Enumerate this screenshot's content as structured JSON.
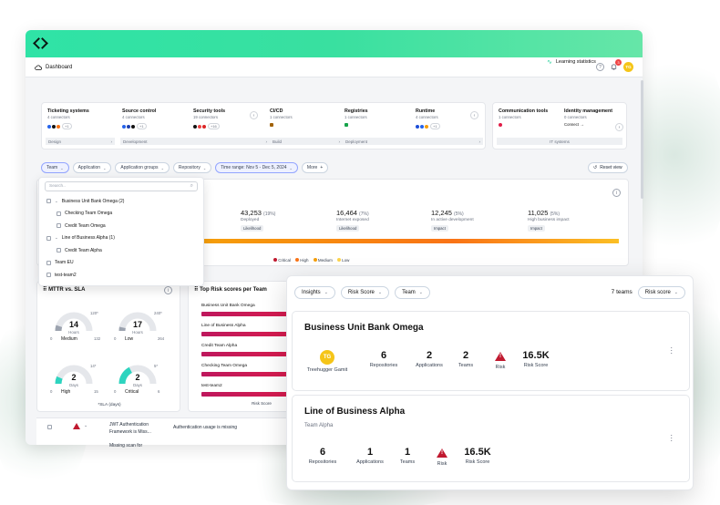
{
  "header": {
    "breadcrumb": "Dashboard",
    "notif_count": "3",
    "avatar": "TG"
  },
  "learning": "Learning statistics",
  "connectors": [
    {
      "title": "Ticketing systems",
      "sub": "4 connectors",
      "plus": "+1",
      "cat": "Design"
    },
    {
      "title": "Source control",
      "sub": "4 connectors",
      "plus": "+1",
      "cat": "Development"
    },
    {
      "title": "Security tools",
      "sub": "19 connectors",
      "plus": "+16",
      "cat": ""
    },
    {
      "title": "CI/CD",
      "sub": "1 connectors",
      "plus": "",
      "cat": "Build"
    },
    {
      "title": "Registries",
      "sub": "1 connectors",
      "plus": "",
      "cat": "Deployment"
    },
    {
      "title": "Runtime",
      "sub": "4 connectors",
      "plus": "+1",
      "cat": ""
    }
  ],
  "connectors2": [
    {
      "title": "Communication tools",
      "sub": "1 connectors"
    },
    {
      "title": "Identity management",
      "sub": "0 connectors",
      "link": "Connect →"
    }
  ],
  "connectors2_cat": "IT systems",
  "filters": [
    "Team",
    "Application",
    "Application groups",
    "Repository",
    "Time range: Nov 5 - Dec 5, 2024",
    "More"
  ],
  "reset": "Reset view",
  "stats": [
    {
      "num": "43,253",
      "pct": "(19%)",
      "label": "Deployed",
      "tag": "Likelihood"
    },
    {
      "num": "16,464",
      "pct": "(7%)",
      "label": "Internet exposed",
      "tag": "Likelihood"
    },
    {
      "num": "12,245",
      "pct": "(5%)",
      "label": "In active development",
      "tag": "Impact"
    },
    {
      "num": "11,025",
      "pct": "(5%)",
      "label": "High business impact",
      "tag": "Impact"
    }
  ],
  "legend": [
    "Critical",
    "High",
    "Medium",
    "Low"
  ],
  "legend_colors": [
    "#c0192f",
    "#f97316",
    "#f59e0b",
    "#fcd34d"
  ],
  "dropdown": {
    "search": "Search..",
    "items": [
      {
        "label": "Business Unit Bank Omega (2)",
        "indent": 0,
        "group": true
      },
      {
        "label": "Checking Team Omega",
        "indent": 1
      },
      {
        "label": "Credit Team Omega",
        "indent": 1
      },
      {
        "label": "Line of Business Alpha (1)",
        "indent": 0,
        "group": true
      },
      {
        "label": "Credit Team Alpha",
        "indent": 1
      },
      {
        "label": "Team EU",
        "indent": 0
      },
      {
        "label": "test-team2",
        "indent": 0
      }
    ]
  },
  "mttr": {
    "title": "MTTR vs. SLA",
    "gauges": [
      {
        "value": "14",
        "unit": "Hours",
        "sla": "120*",
        "min": "0",
        "max": "132",
        "sev": "Medium",
        "frac": 0.1
      },
      {
        "value": "17",
        "unit": "Hours",
        "sla": "240*",
        "min": "0",
        "max": "264",
        "sev": "Low",
        "frac": 0.07
      },
      {
        "value": "2",
        "unit": "Days",
        "sla": "14*",
        "min": "0",
        "max": "15",
        "sev": "High",
        "frac": 0.13
      },
      {
        "value": "2",
        "unit": "Days",
        "sla": "5*",
        "min": "0",
        "max": "6",
        "sev": "Critical",
        "frac": 0.35
      }
    ],
    "note": "*SLA (days)"
  },
  "toprisk": {
    "title": "Top Risk scores per Team",
    "rows": [
      {
        "label": "Business Unit Bank Omega",
        "frac": 1.0
      },
      {
        "label": "Line of Business Alpha",
        "frac": 0.95
      },
      {
        "label": "Credit Team Alpha",
        "frac": 0.95
      },
      {
        "label": "Checking Team Omega",
        "frac": 0.95
      },
      {
        "label": "test-team2",
        "frac": 0.95
      }
    ],
    "foot": "Risk Score"
  },
  "table": {
    "title1": "JWT Authentication",
    "title2": "Framework is Miss...",
    "desc": "Authentication usage is missing",
    "next": "Missing scan for"
  },
  "pop": {
    "chips": [
      "Insights",
      "Risk Score",
      "Team"
    ],
    "teams": "7 teams",
    "sort": "Risk score",
    "cards": [
      {
        "name": "Business Unit Bank Omega",
        "owner": "Treehugger Gamit",
        "owner_init": "TG",
        "repos": "6",
        "apps": "2",
        "teams": "2",
        "score": "16.5K"
      },
      {
        "name": "Line of Business Alpha",
        "sub": "Team Alpha",
        "repos": "6",
        "apps": "1",
        "teams": "1",
        "score": "16.5K"
      }
    ],
    "labels": {
      "repos": "Repositories",
      "apps": "Applications",
      "teams": "Teams",
      "risk": "Risk",
      "score": "Risk Score"
    }
  }
}
